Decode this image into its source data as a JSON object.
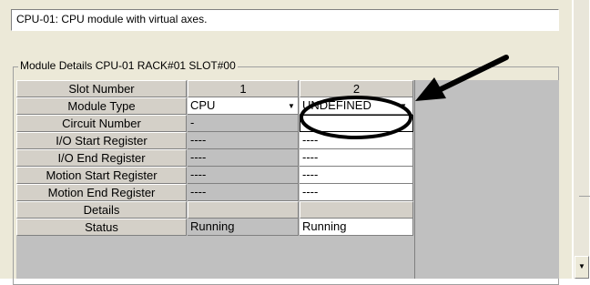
{
  "description": "CPU-01: CPU module with virtual axes.",
  "module_details_title": "Module Details  CPU-01  RACK#01  SLOT#00",
  "grid": {
    "row_headers": [
      "Slot Number",
      "Module Type",
      "Circuit Number",
      "I/O Start Register",
      "I/O End Register",
      "Motion Start Register",
      "Motion End Register",
      "Details",
      "Status"
    ],
    "slot1": {
      "number": "1",
      "module_type": "CPU",
      "circuit_number": "-",
      "io_start": "----",
      "io_end": "----",
      "motion_start": "----",
      "motion_end": "----",
      "details": "",
      "status": "Running"
    },
    "slot2": {
      "number": "2",
      "module_type": "UNDEFINED",
      "circuit_number": "-",
      "io_start": "----",
      "io_end": "----",
      "motion_start": "----",
      "motion_end": "----",
      "details": "",
      "status": "Running"
    }
  },
  "icons": {
    "dropdown": "chevron-down-icon",
    "annotation": "arrow-icon",
    "highlight": "ellipse-highlight"
  },
  "colors": {
    "dialog_bg": "#ece9d8",
    "grid_gray": "#c0c0c0",
    "annotation": "#000000"
  }
}
